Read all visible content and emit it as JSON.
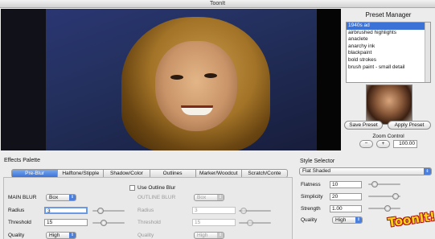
{
  "window": {
    "title": "ToonIt"
  },
  "preset_manager": {
    "title": "Preset Manager",
    "presets": [
      "1940s ad",
      "airbrushed highlights",
      "anaclete",
      "anarchy ink",
      "blackpaint",
      "bold strokes",
      "brush paint - small detail"
    ],
    "selected_index": 0,
    "save_label": "Save Preset",
    "apply_label": "Apply Preset"
  },
  "zoom": {
    "label": "Zoom Control",
    "minus": "−",
    "plus": "+",
    "value": "100.00"
  },
  "effects": {
    "title": "Effects Palette",
    "tabs": [
      "Pre-Blur",
      "Halftone/Stipple",
      "Shadow/Color",
      "Outlines",
      "Marker/Woodcut",
      "Scratch/Conte"
    ],
    "active_tab": 0,
    "main_blur": {
      "label": "MAIN BLUR",
      "type": "Box",
      "radius_label": "Radius",
      "radius": "3",
      "threshold_label": "Threshold",
      "threshold": "15",
      "quality_label": "Quality",
      "quality": "High"
    },
    "outline_blur": {
      "checkbox_label": "Use Outline Blur",
      "label": "OUTLINE BLUR",
      "type": "Box",
      "radius_label": "Radius",
      "radius": "3",
      "threshold_label": "Threshold",
      "threshold": "15",
      "quality_label": "Quality",
      "quality": "High"
    }
  },
  "style_selector": {
    "title": "Style Selector",
    "selected": "Flat Shaded",
    "flatness_label": "Flatness",
    "flatness": "10",
    "simplicity_label": "Simplicity",
    "simplicity": "20",
    "strength_label": "Strength",
    "strength": "1.00",
    "quality_label": "Quality",
    "quality": "High"
  },
  "logo": {
    "text": "ToonIt!"
  },
  "colors": {
    "accent": "#3a72d8",
    "logo": "#ffd21a"
  }
}
